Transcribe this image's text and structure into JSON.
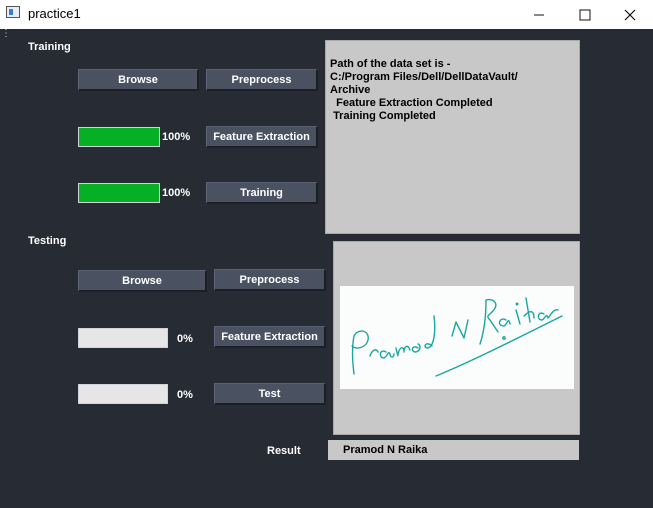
{
  "window": {
    "title": "practice1",
    "minimize_icon": "minimize-icon",
    "maximize_icon": "maximize-icon",
    "close_icon": "close-icon"
  },
  "training": {
    "label": "Training",
    "browse_label": "Browse",
    "preprocess_label": "Preprocess",
    "feature_progress": 1.0,
    "feature_pct": "100%",
    "feature_label": "Feature Extraction",
    "training_progress": 1.0,
    "training_pct": "100%",
    "training_label": "Training",
    "log": "Path of the data set is -\nC:/Program Files/Dell/DellDataVault/\nArchive\n  Feature Extraction Completed\n Training Completed"
  },
  "testing": {
    "label": "Testing",
    "browse_label": "Browse",
    "preprocess_label": "Preprocess",
    "feature_progress": 0,
    "feature_pct": "0%",
    "feature_label": "Feature Extraction",
    "test_progress": 0,
    "test_pct": "0%",
    "test_label": "Test",
    "signature_text": "Pramod N Raika"
  },
  "result": {
    "label": "Result",
    "value": "Pramod N Raika"
  },
  "colors": {
    "background": "#272b34",
    "button": "#4a5261",
    "progress_fill": "#06b025",
    "panel": "#c8c8c8",
    "signature_ink": "#1aa6a0"
  }
}
